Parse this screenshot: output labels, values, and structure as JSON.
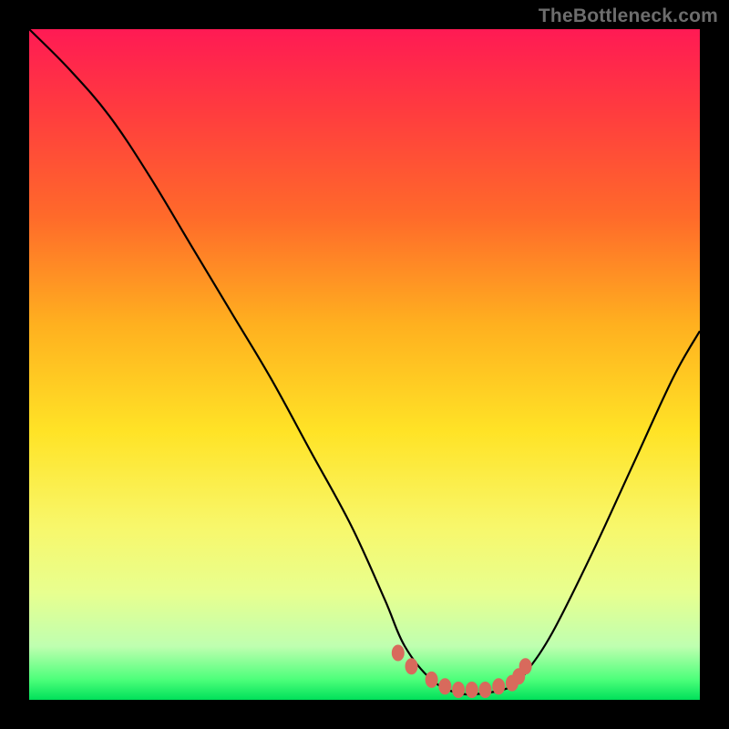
{
  "watermark": "TheBottleneck.com",
  "chart_data": {
    "type": "line",
    "title": "",
    "xlabel": "",
    "ylabel": "",
    "xlim": [
      0,
      100
    ],
    "ylim": [
      0,
      100
    ],
    "series": [
      {
        "name": "bottleneck-curve",
        "x": [
          0,
          6,
          12,
          18,
          24,
          30,
          36,
          42,
          48,
          53,
          56,
          60,
          64,
          68,
          72,
          74,
          78,
          84,
          90,
          96,
          100
        ],
        "y": [
          100,
          94,
          87,
          78,
          68,
          58,
          48,
          37,
          26,
          15,
          8,
          3,
          1,
          1,
          2,
          4,
          10,
          22,
          35,
          48,
          55
        ]
      }
    ],
    "markers": {
      "name": "optimal-range-dots",
      "color": "#d86a5c",
      "points": [
        {
          "x": 55,
          "y": 7
        },
        {
          "x": 57,
          "y": 5
        },
        {
          "x": 60,
          "y": 3
        },
        {
          "x": 62,
          "y": 2
        },
        {
          "x": 64,
          "y": 1.5
        },
        {
          "x": 66,
          "y": 1.5
        },
        {
          "x": 68,
          "y": 1.5
        },
        {
          "x": 70,
          "y": 2
        },
        {
          "x": 72,
          "y": 2.5
        },
        {
          "x": 73,
          "y": 3.5
        },
        {
          "x": 74,
          "y": 5
        }
      ]
    },
    "gradient_stops": [
      {
        "pos": 0,
        "color": "#ff1a54"
      },
      {
        "pos": 12,
        "color": "#ff3b3f"
      },
      {
        "pos": 28,
        "color": "#ff6a2a"
      },
      {
        "pos": 44,
        "color": "#ffb01f"
      },
      {
        "pos": 60,
        "color": "#ffe326"
      },
      {
        "pos": 74,
        "color": "#f8f76a"
      },
      {
        "pos": 84,
        "color": "#e8ff8f"
      },
      {
        "pos": 92,
        "color": "#bfffb0"
      },
      {
        "pos": 97,
        "color": "#4cff7a"
      },
      {
        "pos": 100,
        "color": "#00e05a"
      }
    ]
  }
}
